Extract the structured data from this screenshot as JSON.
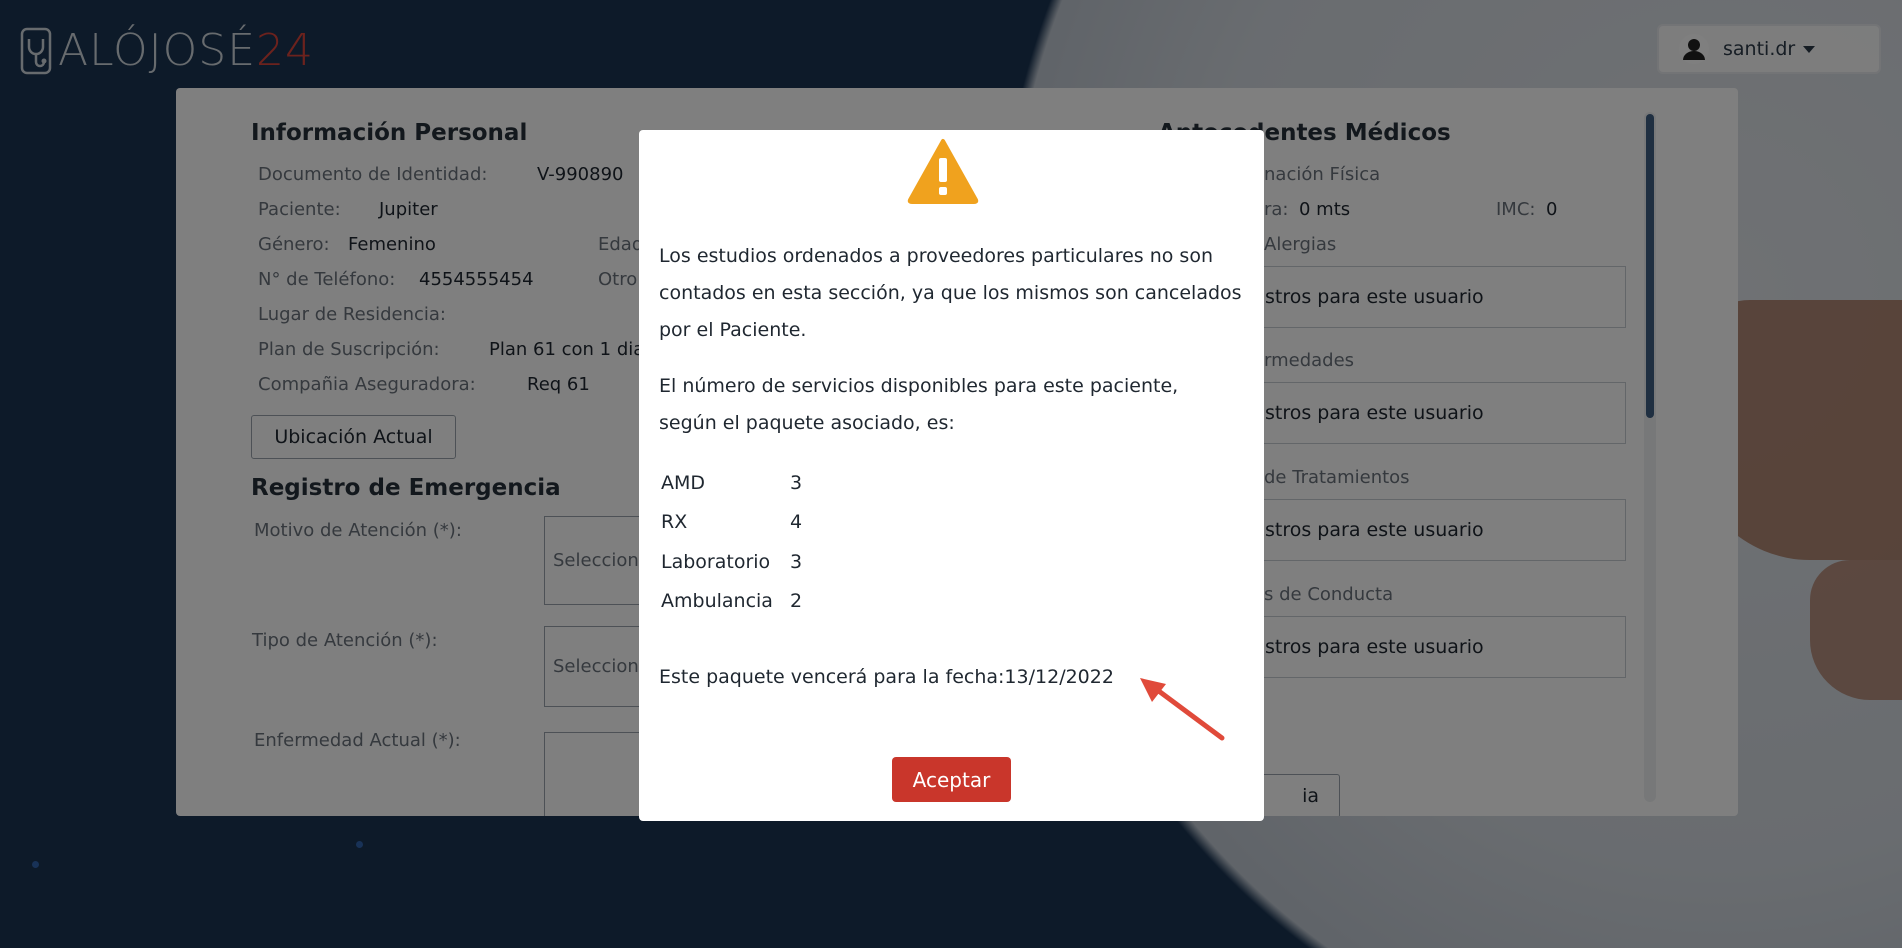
{
  "header": {
    "logo_text_main": "ALÓJOSÉ",
    "logo_text_accent": "24",
    "user_name": "santi.dr"
  },
  "personal_info": {
    "title": "Información Personal",
    "document_label": "Documento de Identidad:",
    "document_value": "V-990890",
    "patient_label": "Paciente:",
    "patient_value": "Jupiter",
    "gender_label": "Género:",
    "gender_value": "Femenino",
    "age_label": "Edad",
    "phone_label": "N° de Teléfono:",
    "phone_value": "4554555454",
    "other_label": "Otro",
    "residence_label": "Lugar de Residencia:",
    "plan_label": "Plan de Suscripción:",
    "plan_value": "Plan 61 con 1 dia",
    "insurer_label": "Compañia Aseguradora:",
    "insurer_value": "Req 61",
    "location_button": "Ubicación Actual"
  },
  "emergency": {
    "title": "Registro de Emergencia",
    "reason_label": "Motivo de Atención (*):",
    "reason_placeholder": "Seleccion",
    "type_label": "Tipo de Atención (*):",
    "type_placeholder": "Seleccion",
    "illness_label": "Enfermedad Actual (*):"
  },
  "medical_history": {
    "title": "Antecedentes Médicos",
    "physical_label": "nación Física",
    "height_label": "ra:",
    "height_value": "0 mts",
    "imc_label": "IMC:",
    "imc_value": "0",
    "allergies_label": "Alergias",
    "diseases_label": "rmedades",
    "treatments_label": "de Tratamientos",
    "conduct_label": "s de Conducta",
    "empty_text": "stros para este usuario",
    "partial_button": "ia"
  },
  "modal": {
    "paragraph1": "Los estudios ordenados a proveedores particulares no son contados en esta sección, ya que los mismos son cancelados por el Paciente.",
    "paragraph2": "El número de servicios disponibles para este paciente, según el paquete asociado, es:",
    "services": [
      {
        "name": "AMD",
        "count": "3"
      },
      {
        "name": "RX",
        "count": "4"
      },
      {
        "name": "Laboratorio",
        "count": "3"
      },
      {
        "name": "Ambulancia",
        "count": "2"
      }
    ],
    "expiry_text": "Este paquete vencerá para la fecha:13/12/2022",
    "accept_button": "Aceptar"
  },
  "colors": {
    "accent_red": "#c9362b",
    "warning_orange": "#f0a21e",
    "navy": "#1a3452"
  }
}
